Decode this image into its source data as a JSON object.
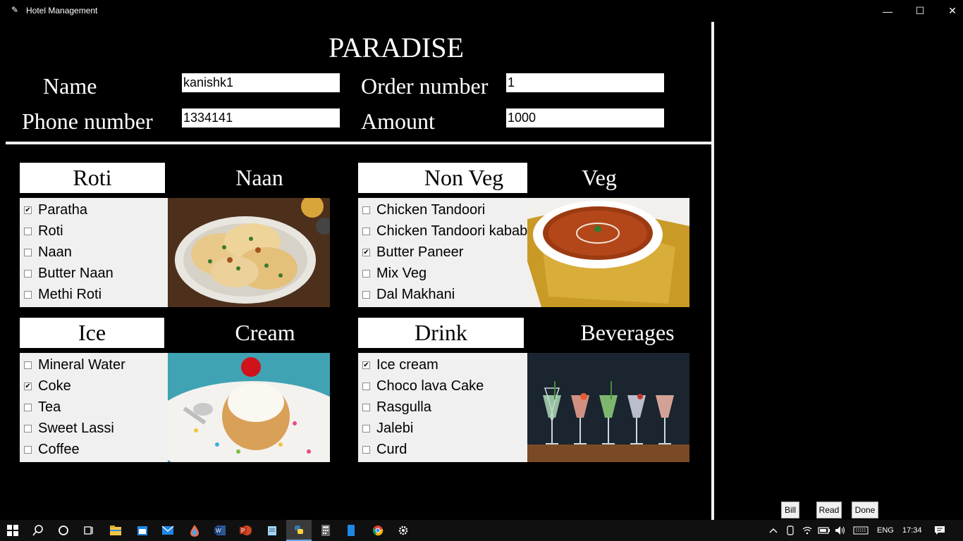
{
  "window": {
    "title": "Hotel Management",
    "minimize": "—",
    "maximize": "☐",
    "close": "✕"
  },
  "header": {
    "title": "PARADISE",
    "name_label": "Name",
    "name_value": "kanishk1",
    "phone_label": "Phone number",
    "phone_value": "1334141",
    "order_label": "Order number",
    "order_value": "1",
    "amount_label": "Amount",
    "amount_value": "1000"
  },
  "sections": {
    "roti": {
      "box_label": "Roti",
      "side_label": "Naan",
      "items": [
        {
          "label": "Paratha",
          "checked": true
        },
        {
          "label": "Roti",
          "checked": false
        },
        {
          "label": "Naan",
          "checked": false
        },
        {
          "label": "Butter Naan",
          "checked": false
        },
        {
          "label": "Methi Roti",
          "checked": false
        }
      ]
    },
    "nonveg": {
      "box_label": "Non Veg",
      "side_label": "Veg",
      "items": [
        {
          "label": "Chicken Tandoori",
          "checked": false
        },
        {
          "label": "Chicken Tandoori kabab",
          "checked": false
        },
        {
          "label": "Butter Paneer",
          "checked": true
        },
        {
          "label": "Mix Veg",
          "checked": false
        },
        {
          "label": "Dal Makhani",
          "checked": false
        }
      ]
    },
    "ice": {
      "box_label": "Ice",
      "side_label": "Cream",
      "items": [
        {
          "label": "Mineral Water",
          "checked": false
        },
        {
          "label": "Coke",
          "checked": true
        },
        {
          "label": "Tea",
          "checked": false
        },
        {
          "label": "Sweet Lassi",
          "checked": false
        },
        {
          "label": "Coffee",
          "checked": false
        }
      ]
    },
    "drink": {
      "box_label": "Drink",
      "side_label": "Beverages",
      "items": [
        {
          "label": "Ice cream",
          "checked": true
        },
        {
          "label": "Choco lava Cake",
          "checked": false
        },
        {
          "label": "Rasgulla",
          "checked": false
        },
        {
          "label": "Jalebi",
          "checked": false
        },
        {
          "label": "Curd",
          "checked": false
        }
      ]
    }
  },
  "buttons": {
    "bill": "Bill",
    "read": "Read",
    "done": "Done"
  },
  "taskbar": {
    "language": "ENG",
    "time": "17:34"
  },
  "colors": {
    "background": "#000000",
    "panel": "#f0f0f0",
    "taskbar": "#101010"
  }
}
